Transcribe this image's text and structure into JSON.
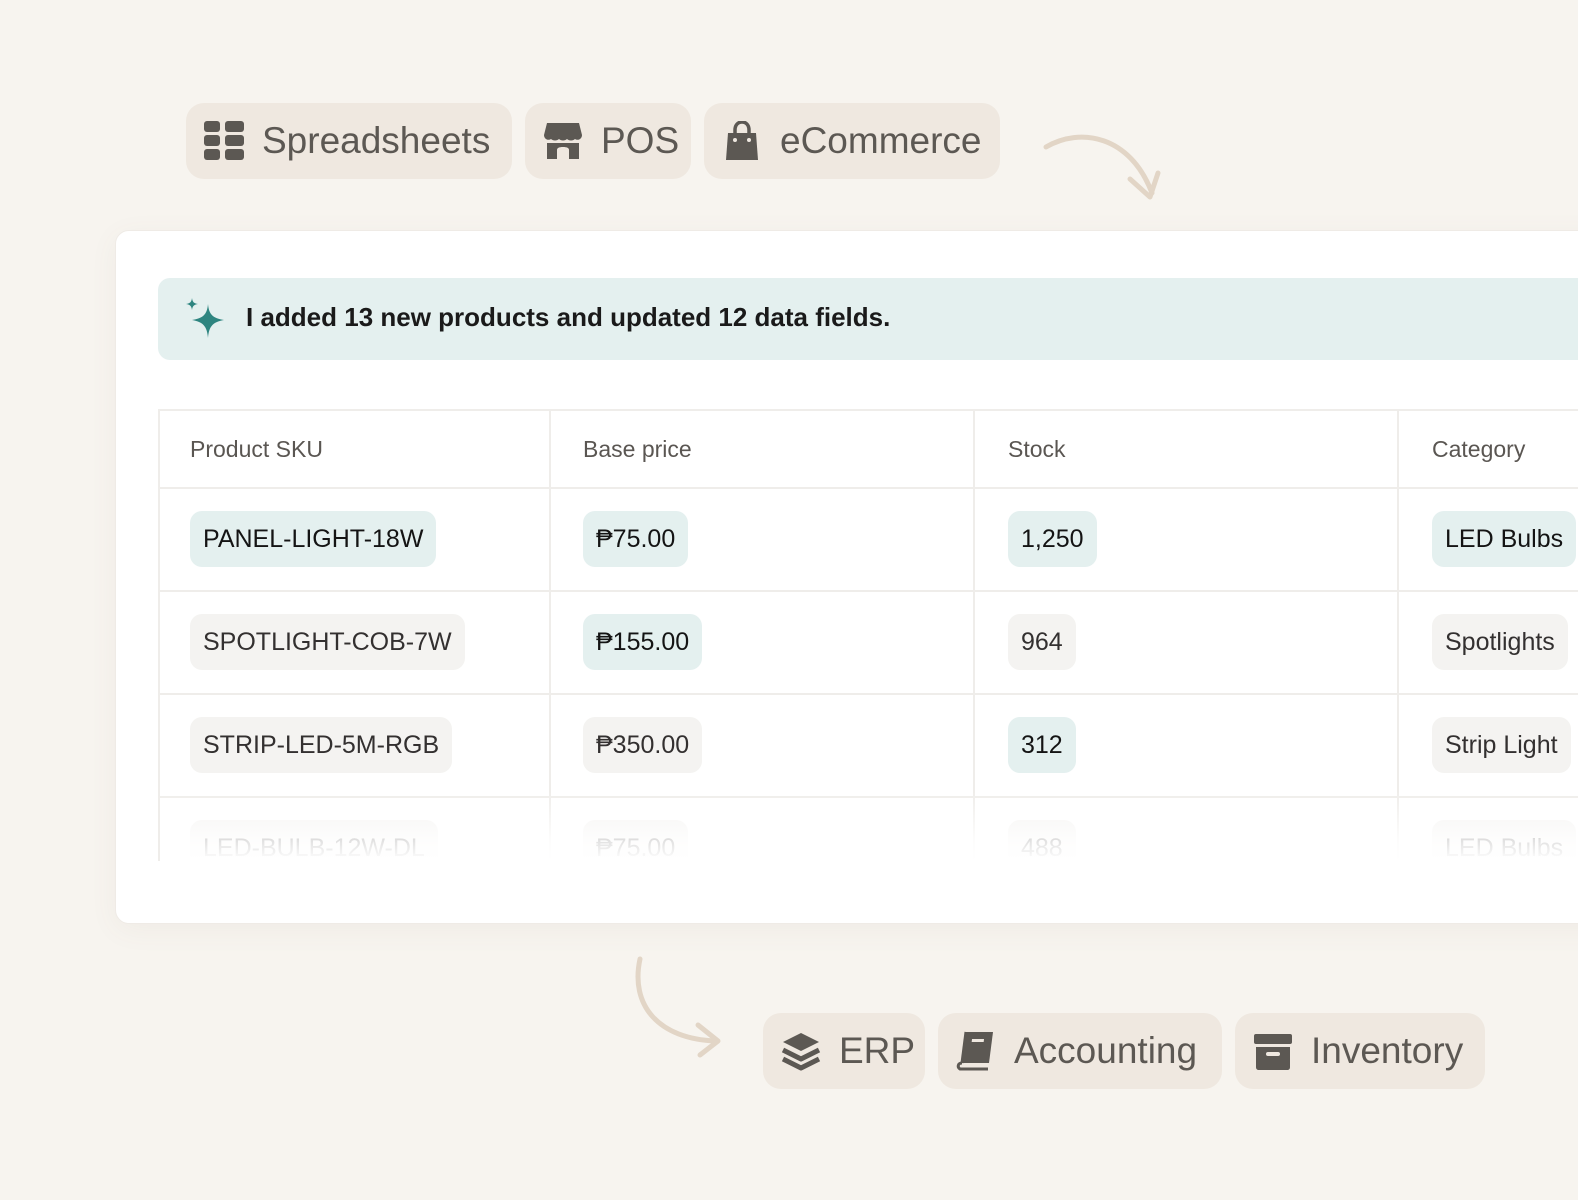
{
  "sources": [
    {
      "label": "Spreadsheets",
      "icon": "grid-icon"
    },
    {
      "label": "POS",
      "icon": "storefront-icon"
    },
    {
      "label": "eCommerce",
      "icon": "shopping-bag-icon"
    }
  ],
  "banner": {
    "text": "I added 13 new products and updated 12 data fields.",
    "icon": "sparkle-icon"
  },
  "table": {
    "headers": [
      "Product SKU",
      "Base price",
      "Stock",
      "Category"
    ],
    "rows": [
      {
        "sku": "PANEL-LIGHT-18W",
        "price": "₱75.00",
        "stock": "1,250",
        "category": "LED Bulbs",
        "highlight": [
          true,
          true,
          true,
          true
        ]
      },
      {
        "sku": "SPOTLIGHT-COB-7W",
        "price": "₱155.00",
        "stock": "964",
        "category": "Spotlights",
        "highlight": [
          false,
          true,
          false,
          false
        ]
      },
      {
        "sku": "STRIP-LED-5M-RGB",
        "price": "₱350.00",
        "stock": "312",
        "category": "Strip Light",
        "highlight": [
          false,
          false,
          true,
          false
        ]
      },
      {
        "sku": "LED-BULB-12W-DL",
        "price": "₱75.00",
        "stock": "488",
        "category": "LED Bulbs",
        "highlight": [
          false,
          false,
          false,
          false
        ]
      }
    ]
  },
  "destinations": [
    {
      "label": "ERP",
      "icon": "layers-icon"
    },
    {
      "label": "Accounting",
      "icon": "book-icon"
    },
    {
      "label": "Inventory",
      "icon": "archive-box-icon"
    }
  ],
  "colors": {
    "background": "#f7f4ef",
    "chip": "#efe8e0",
    "accent": "#2e8580",
    "highlight": "#e4f0ef"
  }
}
